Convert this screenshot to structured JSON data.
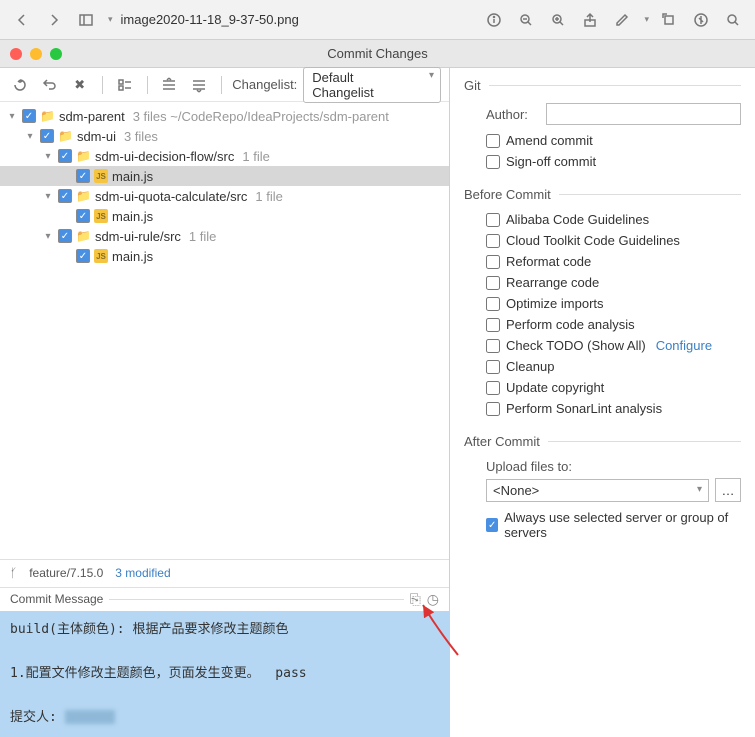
{
  "top_toolbar": {
    "filename": "image2020-11-18_9-37-50.png"
  },
  "window": {
    "title": "Commit Changes"
  },
  "left": {
    "changelist_label": "Changelist:",
    "changelist_value": "Default Changelist",
    "tree": {
      "root": {
        "label": "sdm-parent",
        "meta": "3 files  ~/CodeRepo/IdeaProjects/sdm-parent"
      },
      "ui": {
        "label": "sdm-ui",
        "meta": "3 files"
      },
      "decision": {
        "label": "sdm-ui-decision-flow/src",
        "meta": "1 file",
        "file": "main.js"
      },
      "quota": {
        "label": "sdm-ui-quota-calculate/src",
        "meta": "1 file",
        "file": "main.js"
      },
      "rule": {
        "label": "sdm-ui-rule/src",
        "meta": "1 file",
        "file": "main.js"
      }
    },
    "branch": "feature/7.15.0",
    "modified": "3 modified",
    "commit_msg_label": "Commit Message",
    "commit_msg": "build(主体颜色): 根据产品要求修改主题颜色\n\n1.配置文件修改主题颜色，页面发生变更。  pass\n\n提交人: "
  },
  "right": {
    "git_title": "Git",
    "author_label": "Author:",
    "amend": "Amend commit",
    "signoff": "Sign-off commit",
    "before_title": "Before Commit",
    "before_items": [
      "Alibaba Code Guidelines",
      "Cloud Toolkit Code Guidelines",
      "Reformat code",
      "Rearrange code",
      "Optimize imports",
      "Perform code analysis",
      "Check TODO (Show All)",
      "Cleanup",
      "Update copyright",
      "Perform SonarLint analysis"
    ],
    "configure": "Configure",
    "after_title": "After Commit",
    "upload_label": "Upload files to:",
    "upload_value": "<None>",
    "always_use": "Always use selected server or group of servers"
  }
}
